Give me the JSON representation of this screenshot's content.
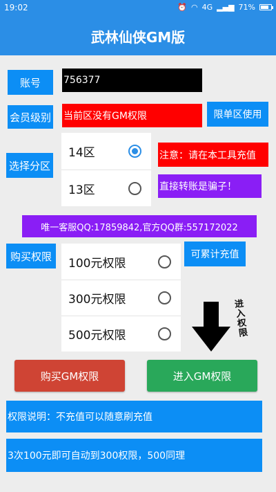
{
  "status_bar": {
    "time": "19:02",
    "network": "4G",
    "battery": "71%"
  },
  "title": "武林仙侠GM版",
  "account": {
    "label": "账号",
    "value": "756377"
  },
  "member": {
    "label": "会员级别",
    "value": "当前区没有GM权限",
    "note": "限单区使用"
  },
  "zone": {
    "label": "选择分区",
    "options": [
      {
        "label": "14区",
        "checked": true
      },
      {
        "label": "13区",
        "checked": false
      }
    ]
  },
  "warning": {
    "line1": "注意：请在本工具充值",
    "line2": "直接转账是骗子！"
  },
  "contact": "唯一客服QQ:17859842,官方QQ群:557172022",
  "buy": {
    "label": "购买权限",
    "note": "可累计充值",
    "options": [
      {
        "label": "100元权限"
      },
      {
        "label": "300元权限"
      },
      {
        "label": "500元权限"
      }
    ]
  },
  "arrow_label": "进入权限",
  "actions": {
    "buy_button": "购买GM权限",
    "enter_button": "进入GM权限"
  },
  "info": {
    "line1": "权限说明：不充值可以随意刷充值",
    "line2": "3次100元即可自动到300权限，500同理"
  },
  "colors": {
    "primary": "#2b8ee6",
    "label_blue": "#0c8ef5",
    "red": "#ff0000",
    "purple": "#8a1ef5",
    "buy_button": "#cf4434",
    "enter_button": "#29a85a"
  }
}
